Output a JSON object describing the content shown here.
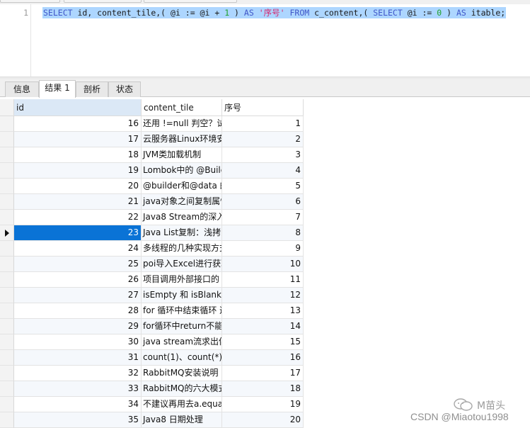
{
  "editor": {
    "line_number": "1",
    "tokens": [
      {
        "t": "SELECT",
        "c": "kw"
      },
      {
        "t": " id, content_tile,( @i := @i + ",
        "c": "id"
      },
      {
        "t": "1",
        "c": "num"
      },
      {
        "t": " ) ",
        "c": "id"
      },
      {
        "t": "AS",
        "c": "kw"
      },
      {
        "t": " ",
        "c": "id"
      },
      {
        "t": "'序号'",
        "c": "str"
      },
      {
        "t": " ",
        "c": "id"
      },
      {
        "t": "FROM",
        "c": "kw"
      },
      {
        "t": " c_content,( ",
        "c": "id"
      },
      {
        "t": "SELECT",
        "c": "kw"
      },
      {
        "t": " @i := ",
        "c": "id"
      },
      {
        "t": "0",
        "c": "num"
      },
      {
        "t": " ) ",
        "c": "id"
      },
      {
        "t": "AS",
        "c": "kw"
      },
      {
        "t": " itable;",
        "c": "id"
      }
    ]
  },
  "tabs": [
    {
      "label": "信息",
      "active": false
    },
    {
      "label": "结果 1",
      "active": true
    },
    {
      "label": "剖析",
      "active": false
    },
    {
      "label": "状态",
      "active": false
    }
  ],
  "grid": {
    "columns": [
      "id",
      "content_tile",
      "序号"
    ],
    "current_row_index": 7,
    "rows": [
      {
        "id": "16",
        "title": "还用 !=null 判空？试",
        "seq": "1"
      },
      {
        "id": "17",
        "title": "云服务器Linux环境安",
        "seq": "2"
      },
      {
        "id": "18",
        "title": "JVM类加载机制",
        "seq": "3"
      },
      {
        "id": "19",
        "title": "Lombok中的 @Builc",
        "seq": "4"
      },
      {
        "id": "20",
        "title": "@builder和@data 的",
        "seq": "5"
      },
      {
        "id": "21",
        "title": "java对象之间复制属性",
        "seq": "6"
      },
      {
        "id": "22",
        "title": "Java8 Stream的深入",
        "seq": "7"
      },
      {
        "id": "23",
        "title": "Java List复制：浅拷贝",
        "seq": "8"
      },
      {
        "id": "24",
        "title": "多线程的几种实现方式",
        "seq": "9"
      },
      {
        "id": "25",
        "title": "poi导入Excel进行获取",
        "seq": "10"
      },
      {
        "id": "26",
        "title": "项目调用外部接口的",
        "seq": "11"
      },
      {
        "id": "27",
        "title": "isEmpty 和 isBlank 的",
        "seq": "12"
      },
      {
        "id": "28",
        "title": "for 循环中结束循环 这",
        "seq": "13"
      },
      {
        "id": "29",
        "title": "for循环中return不能",
        "seq": "14"
      },
      {
        "id": "30",
        "title": "java stream流求出偶",
        "seq": "15"
      },
      {
        "id": "31",
        "title": "count(1)、count(*) 与",
        "seq": "16"
      },
      {
        "id": "32",
        "title": "RabbitMQ安装说明",
        "seq": "17"
      },
      {
        "id": "33",
        "title": "RabbitMQ的六大模式",
        "seq": "18"
      },
      {
        "id": "34",
        "title": "不建议再用去a.equals",
        "seq": "19"
      },
      {
        "id": "35",
        "title": "Java8 日期处理",
        "seq": "20"
      }
    ]
  },
  "watermark": {
    "brand": "M苗头",
    "credit": "CSDN @Miaotou1998"
  }
}
